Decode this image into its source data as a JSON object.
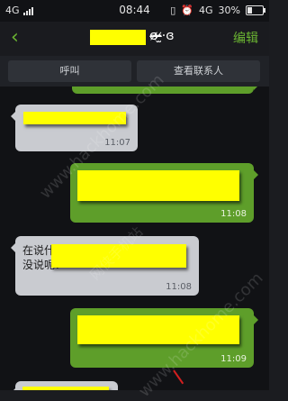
{
  "status_bar": {
    "network_left": "4G",
    "time": "08:44",
    "network_right": "4G",
    "battery": "30%",
    "battery_level": 0.3
  },
  "header": {
    "back_icon": "chevron-left-icon",
    "contact_name_suffix": "ɞ̴̶̷·̴̶̷̫·ɞ",
    "edit_label": "编辑",
    "accent_color": "#6bb532"
  },
  "actions": {
    "call_label": "呼叫",
    "view_contact_label": "查看联系人"
  },
  "messages": [
    {
      "direction": "in",
      "time": "11:07"
    },
    {
      "direction": "out",
      "time": "11:08"
    },
    {
      "direction": "in",
      "time": "11:08",
      "visible_text": "在说什么时候?",
      "visible_text_2": "没说呢?"
    },
    {
      "direction": "out",
      "time": "11:09"
    }
  ],
  "watermark": {
    "line1": "www.hackhome.com",
    "line2": "网侠手机站"
  },
  "colors": {
    "incoming_bubble": "#c9cbd0",
    "outgoing_bubble": "#5e9e2a",
    "redaction": "#ffff00"
  }
}
